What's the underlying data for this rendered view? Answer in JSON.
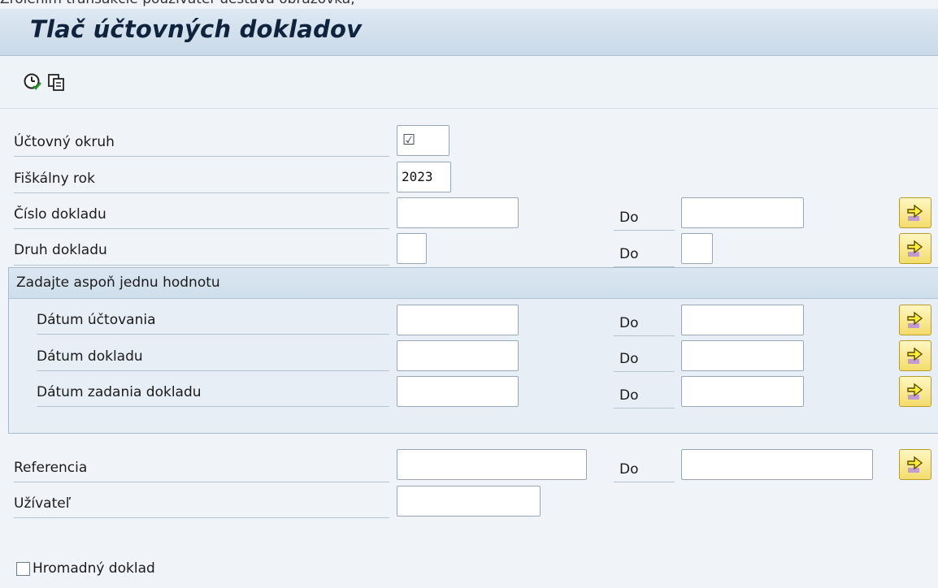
{
  "window": {
    "top_caption": "Zrolením transakcie používateľ uestáva obrazovka,",
    "title": "Tlač účtovných dokladov"
  },
  "toolbar": {
    "execute_icon": "clock-execute-icon",
    "variant_icon": "copy-variant-icon"
  },
  "form": {
    "company_code": {
      "label": "Účtovný okruh",
      "value": "☑"
    },
    "fiscal_year": {
      "label": "Fiškálny rok",
      "value": "2023"
    },
    "document_number": {
      "label": "Číslo dokladu",
      "to_label": "Do",
      "from": "",
      "to": ""
    },
    "document_type": {
      "label": "Druh dokladu",
      "to_label": "Do",
      "from": "",
      "to": ""
    },
    "group": {
      "title": "Zadajte aspoň jednu hodnotu",
      "posting_date": {
        "label": "Dátum účtovania",
        "to_label": "Do",
        "from": "",
        "to": ""
      },
      "document_date": {
        "label": "Dátum dokladu",
        "to_label": "Do",
        "from": "",
        "to": ""
      },
      "entry_date": {
        "label": "Dátum zadania dokladu",
        "to_label": "Do",
        "from": "",
        "to": ""
      }
    },
    "reference": {
      "label": "Referencia",
      "to_label": "Do",
      "from": "",
      "to": ""
    },
    "user": {
      "label": "Užívateľ",
      "value": ""
    },
    "mass_document": {
      "label": "Hromadný doklad",
      "checked": false
    }
  },
  "colors": {
    "title_bar": "#c9d9e8",
    "background": "#f0f4f8",
    "arrow_button": "#f3dc6a"
  }
}
